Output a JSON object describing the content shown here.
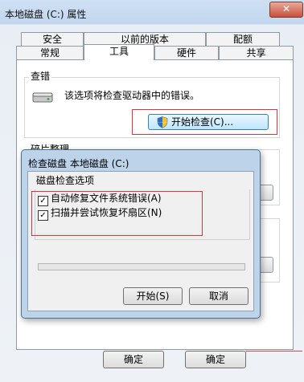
{
  "window": {
    "title": "本地磁盘 (C:) 属性",
    "close_glyph": "✕"
  },
  "tabs": {
    "row1": [
      "安全",
      "以前的版本",
      "配额"
    ],
    "row2": [
      "常规",
      "工具",
      "硬件",
      "共享"
    ],
    "active": "工具"
  },
  "error_check": {
    "group_title": "查错",
    "description": "该选项将检查驱动器中的错误。",
    "button_label": "开始检查(C)...",
    "icons": {
      "disk": "disk-drive-icon",
      "shield": "uac-shield-icon"
    }
  },
  "defrag": {
    "group_title": "碎片整理"
  },
  "dialog": {
    "title": "检查磁盘 本地磁盘 (C:)",
    "options_title": "磁盘检查选项",
    "options": [
      {
        "label": "自动修复文件系统错误(A)",
        "checked": true
      },
      {
        "label": "扫描并尝试恢复坏扇区(N)",
        "checked": true
      }
    ],
    "start_label": "开始(S)",
    "cancel_label": "取消",
    "progress": 0
  },
  "footer": {
    "ok_label": "确定",
    "ok2_label": "确定"
  },
  "colors": {
    "highlight_red": "#d9363e",
    "button_blue": "#bee6fd"
  }
}
